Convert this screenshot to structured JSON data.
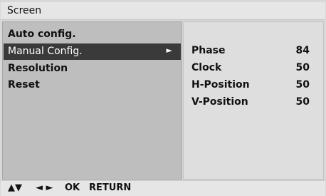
{
  "screen": {
    "title": "Screen"
  },
  "menu": {
    "items": [
      {
        "label": "Auto config."
      },
      {
        "label": "Manual Config.",
        "arrow": "►"
      },
      {
        "label": "Resolution"
      },
      {
        "label": "Reset"
      }
    ]
  },
  "submenu": {
    "rows": [
      {
        "name": "Phase",
        "value": "84"
      },
      {
        "name": "Clock",
        "value": "50"
      },
      {
        "name": "H-Position",
        "value": "50"
      },
      {
        "name": "V-Position",
        "value": "50"
      }
    ]
  },
  "footer": {
    "up_down": "▲▼",
    "left_right": "◄ ►",
    "ok": "OK",
    "return": "RETURN"
  }
}
